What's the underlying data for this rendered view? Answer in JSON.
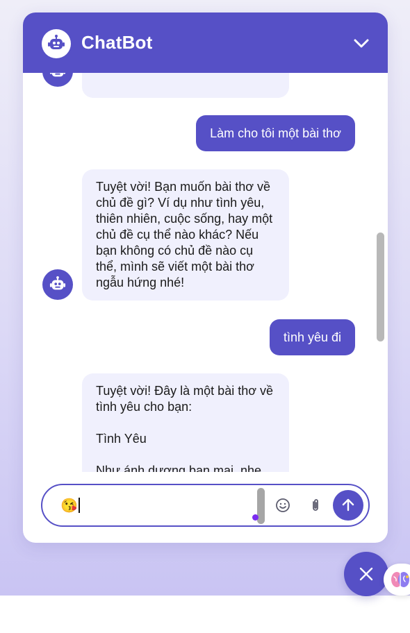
{
  "header": {
    "title": "ChatBot",
    "logo_icon": "robot-icon",
    "collapse_icon": "chevron-down-icon"
  },
  "messages": [
    {
      "role": "bot",
      "text": ""
    },
    {
      "role": "user",
      "text": "Làm cho tôi một bài thơ"
    },
    {
      "role": "bot",
      "text": "Tuyệt vời! Bạn muốn bài thơ về chủ đề gì? Ví dụ như tình yêu, thiên nhiên, cuộc sống, hay một chủ đề cụ thể nào khác? Nếu bạn không có chủ đề nào cụ thể, mình sẽ viết một bài thơ ngẫu hứng nhé!"
    },
    {
      "role": "user",
      "text": "tình yêu đi"
    },
    {
      "role": "bot",
      "text": "Tuyệt vời! Đây là một bài thơ về tình yêu cho bạn:\n\nTình Yêu\n\nNhư ánh dương ban mai, nhẹ nhàng đến"
    }
  ],
  "input": {
    "value": "😘",
    "emoji_icon": "smiley-icon",
    "attach_icon": "paperclip-icon",
    "send_icon": "arrow-up-icon"
  },
  "launcher": {
    "close_icon": "close-icon",
    "brain_icon": "brain-icon"
  },
  "colors": {
    "accent": "#5650c6",
    "bot_bubble": "#f0f0fd",
    "background_top": "#efeef8",
    "background_bottom": "#c9c4f3"
  }
}
